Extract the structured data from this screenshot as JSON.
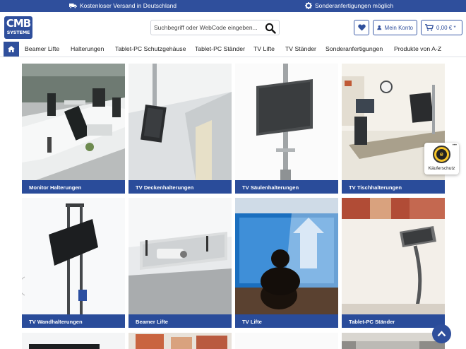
{
  "topbar": {
    "shipping_text": "Kostenloser Versand in Deutschland",
    "custom_text": "Sonderanfertigungen möglich",
    "truck_icon": "truck-icon",
    "gear_icon": "gear-icon"
  },
  "header": {
    "logo": {
      "line1": "CMB",
      "line2": "SYSTEME"
    },
    "search": {
      "placeholder": "Suchbegriff oder WebCode eingeben...",
      "value": ""
    },
    "account_label": "Mein Konto",
    "cart_total": "0,00 € *"
  },
  "nav": {
    "items": [
      {
        "label": "Beamer Lifte"
      },
      {
        "label": "Halterungen"
      },
      {
        "label": "Tablet-PC Schutzgehäuse"
      },
      {
        "label": "Tablet-PC Ständer"
      },
      {
        "label": "TV Lifte"
      },
      {
        "label": "TV Ständer"
      },
      {
        "label": "Sonderanfertigungen"
      },
      {
        "label": "Produkte von A-Z"
      }
    ]
  },
  "categories": [
    {
      "label": "Monitor Halterungen"
    },
    {
      "label": "TV Deckenhalterungen"
    },
    {
      "label": "TV Säulenhalterungen"
    },
    {
      "label": "TV Tischhalterungen"
    },
    {
      "label": "TV Wandhalterungen"
    },
    {
      "label": "Beamer Lifte"
    },
    {
      "label": "TV Lifte"
    },
    {
      "label": "Tablet-PC Ständer"
    }
  ],
  "trust_badge": {
    "label": "Käuferschutz",
    "seal_letter": "e"
  },
  "colors": {
    "brand_blue": "#2f4f9c",
    "caption_blue": "#2a4c9a",
    "seal_yellow": "#f7c52a"
  }
}
